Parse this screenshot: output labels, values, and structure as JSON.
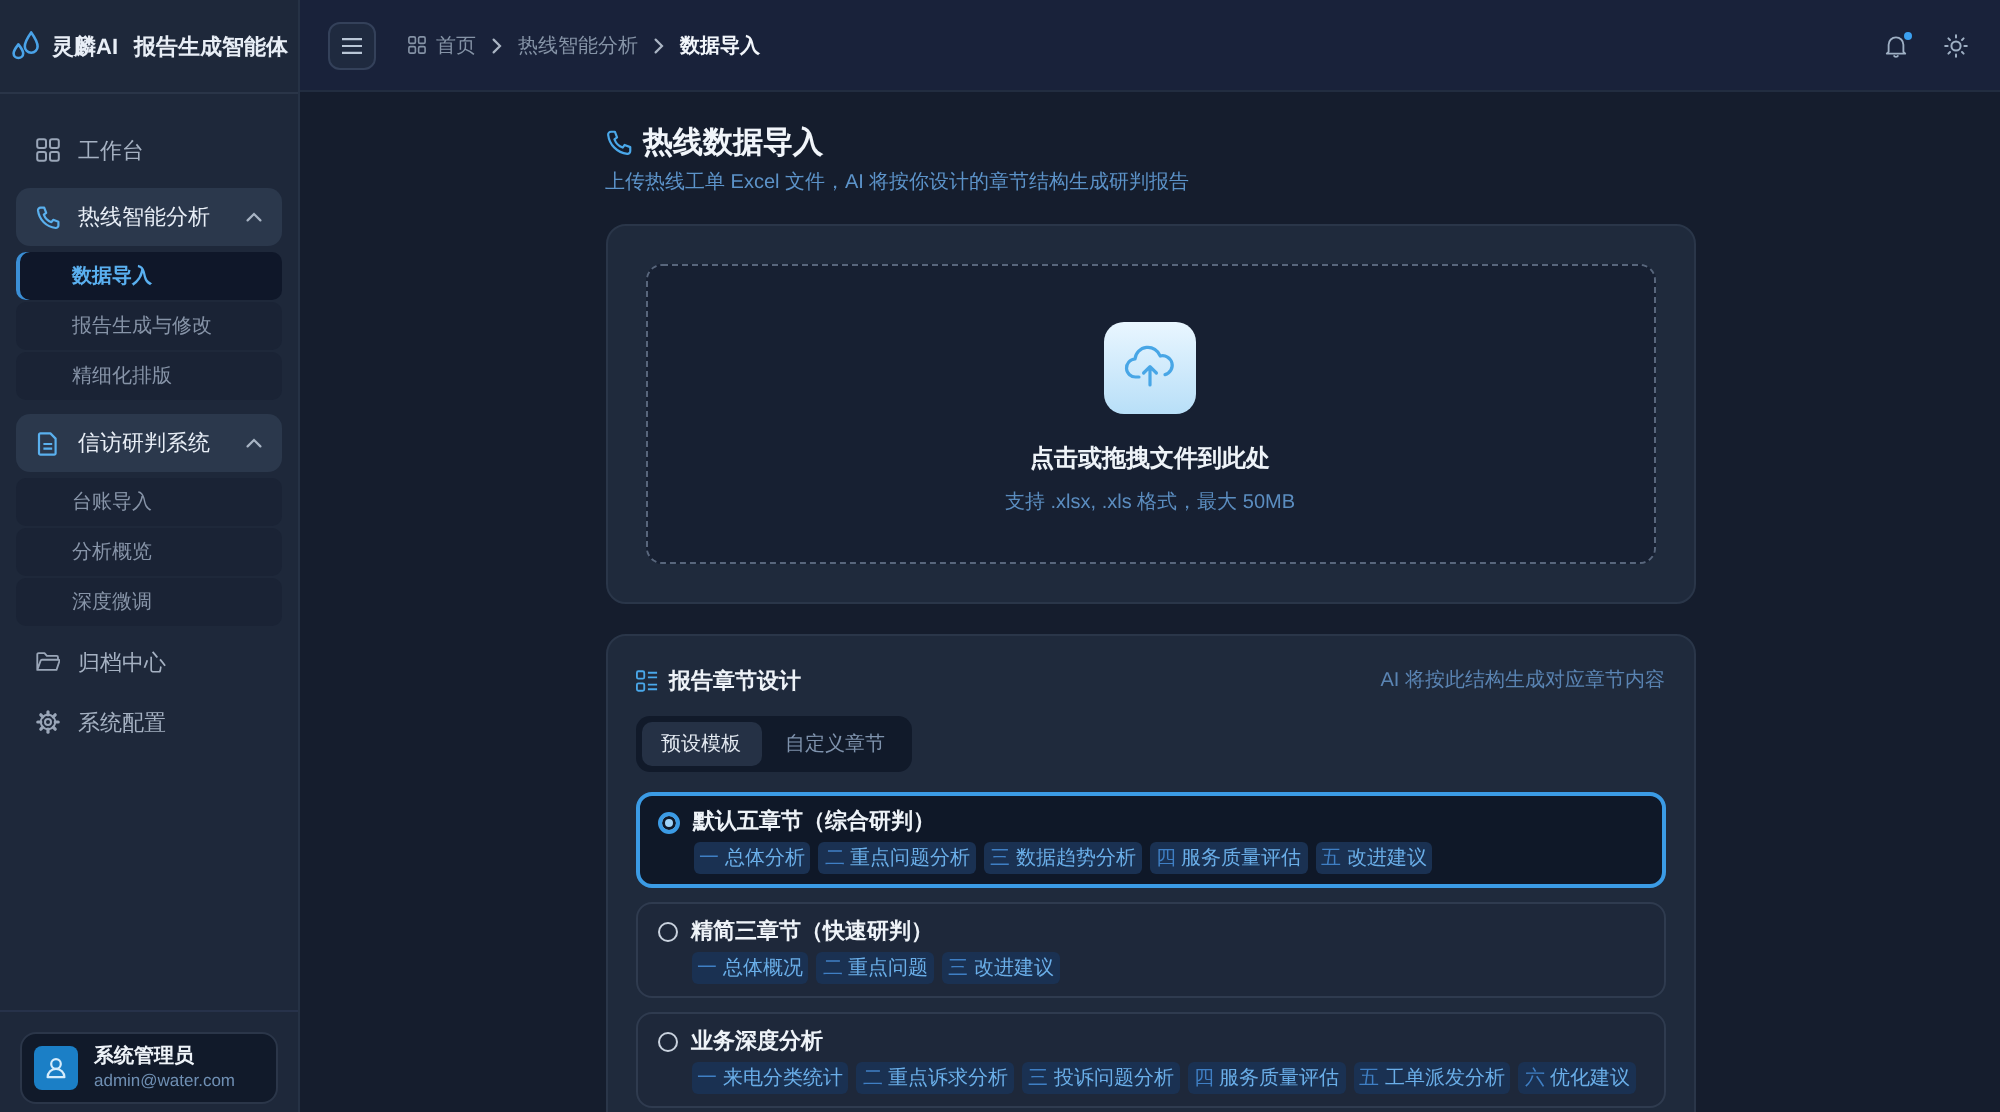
{
  "app": {
    "brand": "灵麟AI",
    "product": "报告生成智能体"
  },
  "sidebar": {
    "items": [
      {
        "kind": "link",
        "label": "工作台",
        "selected": false
      },
      {
        "kind": "group",
        "label": "热线智能分析",
        "expanded": true,
        "children": [
          {
            "label": "数据导入",
            "selected": true
          },
          {
            "label": "报告生成与修改",
            "selected": false
          },
          {
            "label": "精细化排版",
            "selected": false
          }
        ]
      },
      {
        "kind": "group",
        "label": "信访研判系统",
        "expanded": true,
        "children": [
          {
            "label": "台账导入",
            "selected": false
          },
          {
            "label": "分析概览",
            "selected": false
          },
          {
            "label": "深度微调",
            "selected": false
          }
        ]
      },
      {
        "kind": "link",
        "label": "归档中心",
        "selected": false
      },
      {
        "kind": "link",
        "label": "系统配置",
        "selected": false
      }
    ]
  },
  "user": {
    "name": "系统管理员",
    "email": "admin@water.com"
  },
  "header": {
    "breadcrumb": [
      {
        "label": "首页",
        "current": false
      },
      {
        "label": "热线智能分析",
        "current": false
      },
      {
        "label": "数据导入",
        "current": true
      }
    ],
    "unread": true
  },
  "page": {
    "title": "热线数据导入",
    "subtitle": "上传热线工单 Excel 文件，AI 将按你设计的章节结构生成研判报告"
  },
  "upload": {
    "prompt": "点击或拖拽文件到此处",
    "hint": "支持 .xlsx, .xls 格式，最大 50MB"
  },
  "chapters": {
    "title": "报告章节设计",
    "note": "AI 将按此结构生成对应章节内容",
    "tabs": [
      {
        "label": "预设模板",
        "selected": true
      },
      {
        "label": "自定义章节",
        "selected": false
      }
    ],
    "templates": [
      {
        "name": "默认五章节（综合研判）",
        "selected": true,
        "sections": [
          {
            "num": "一",
            "label": "总体分析"
          },
          {
            "num": "二",
            "label": "重点问题分析"
          },
          {
            "num": "三",
            "label": "数据趋势分析"
          },
          {
            "num": "四",
            "label": "服务质量评估"
          },
          {
            "num": "五",
            "label": "改进建议"
          }
        ]
      },
      {
        "name": "精简三章节（快速研判）",
        "selected": false,
        "sections": [
          {
            "num": "一",
            "label": "总体概况"
          },
          {
            "num": "二",
            "label": "重点问题"
          },
          {
            "num": "三",
            "label": "改进建议"
          }
        ]
      },
      {
        "name": "业务深度分析",
        "selected": false,
        "sections": [
          {
            "num": "一",
            "label": "来电分类统计"
          },
          {
            "num": "二",
            "label": "重点诉求分析"
          },
          {
            "num": "三",
            "label": "投诉问题分析"
          },
          {
            "num": "四",
            "label": "服务质量评估"
          },
          {
            "num": "五",
            "label": "工单派发分析"
          },
          {
            "num": "六",
            "label": "优化建议"
          }
        ]
      }
    ]
  }
}
